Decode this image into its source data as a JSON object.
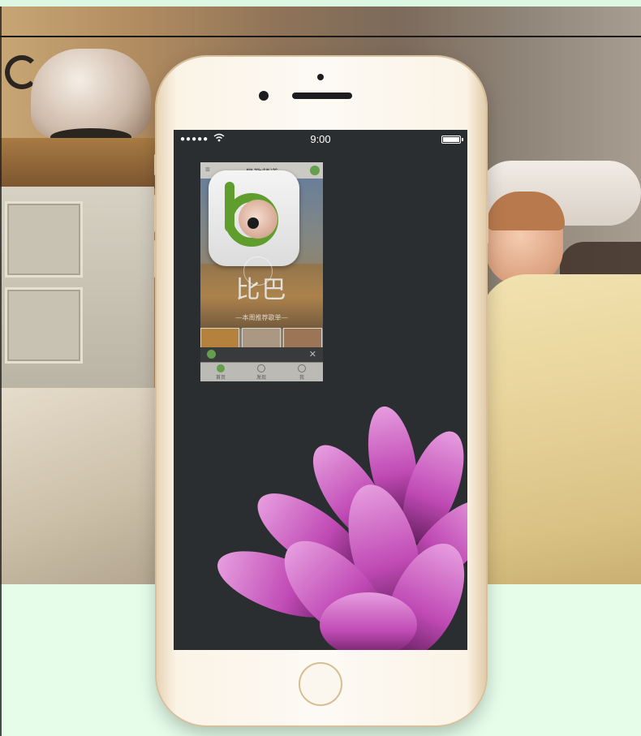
{
  "phone": {
    "status_bar": {
      "signal": "●●●●●",
      "time": "9:00"
    },
    "app_preview": {
      "header_title": "早教频道",
      "brand_name": "比巴",
      "section_subtitle": "—本周推荐歌单—",
      "notice_text": "",
      "tabs": [
        {
          "label": "首页"
        },
        {
          "label": "发现"
        },
        {
          "label": "我"
        }
      ]
    }
  },
  "colors": {
    "page_background": "#e6fdea",
    "brand_green": "#5f9e2c",
    "phone_frame": "#fdfaf5",
    "screen_background": "#2b2e31",
    "flower": "#d94fcf"
  },
  "icons": [
    "wifi-icon",
    "battery-icon",
    "menu-icon",
    "close-icon",
    "home-tab-icon",
    "discover-tab-icon",
    "profile-tab-icon",
    "app-logo-icon"
  ]
}
